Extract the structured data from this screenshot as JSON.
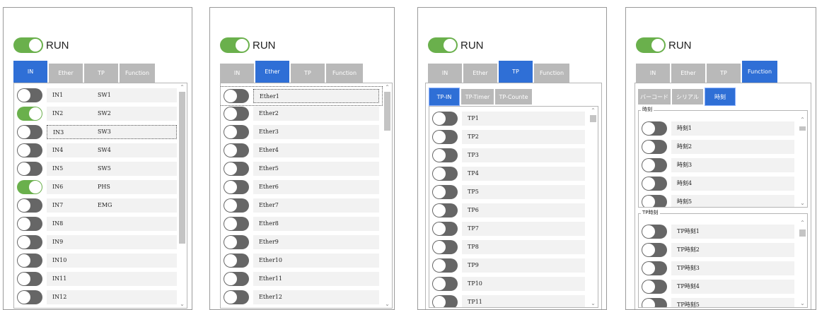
{
  "run_label": "RUN",
  "main_tabs": [
    "IN",
    "Ether",
    "TP",
    "Function"
  ],
  "panel1": {
    "rows": [
      {
        "name": "IN1",
        "value": "SW1",
        "on": false
      },
      {
        "name": "IN2",
        "value": "SW2",
        "on": true
      },
      {
        "name": "IN3",
        "value": "SW3",
        "on": false
      },
      {
        "name": "IN4",
        "value": "SW4",
        "on": false
      },
      {
        "name": "IN5",
        "value": "SW5",
        "on": false
      },
      {
        "name": "IN6",
        "value": "PHS",
        "on": true
      },
      {
        "name": "IN7",
        "value": "EMG",
        "on": false
      },
      {
        "name": "IN8",
        "value": "",
        "on": false
      },
      {
        "name": "IN9",
        "value": "",
        "on": false
      },
      {
        "name": "IN10",
        "value": "",
        "on": false
      },
      {
        "name": "IN11",
        "value": "",
        "on": false
      },
      {
        "name": "IN12",
        "value": "",
        "on": false
      }
    ]
  },
  "panel2": {
    "rows": [
      "Ether1",
      "Ether2",
      "Ether3",
      "Ether4",
      "Ether5",
      "Ether6",
      "Ether7",
      "Ether8",
      "Ether9",
      "Ether10",
      "Ether11",
      "Ether12"
    ]
  },
  "panel3": {
    "subtabs": [
      "TP-IN",
      "TP-Timer",
      "TP-Counte"
    ],
    "rows": [
      "TP1",
      "TP2",
      "TP3",
      "TP4",
      "TP5",
      "TP6",
      "TP7",
      "TP8",
      "TP9",
      "TP10",
      "TP11"
    ]
  },
  "panel4": {
    "subtabs": [
      "バーコード",
      "シリアル",
      "時刻"
    ],
    "group1_label": "時刻",
    "group1_rows": [
      "時刻1",
      "時刻2",
      "時刻3",
      "時刻4",
      "時刻5"
    ],
    "group2_label": "TP時刻",
    "group2_rows": [
      "TP時刻1",
      "TP時刻2",
      "TP時刻3",
      "TP時刻4",
      "TP時刻5"
    ]
  },
  "icons": {
    "scroll_up": "chevron-up-icon",
    "scroll_down": "chevron-down-icon"
  },
  "colors": {
    "accent": "#2f6fd6",
    "on": "#6ab04c",
    "off": "#666666",
    "tab_inactive": "#b9b9b9"
  }
}
